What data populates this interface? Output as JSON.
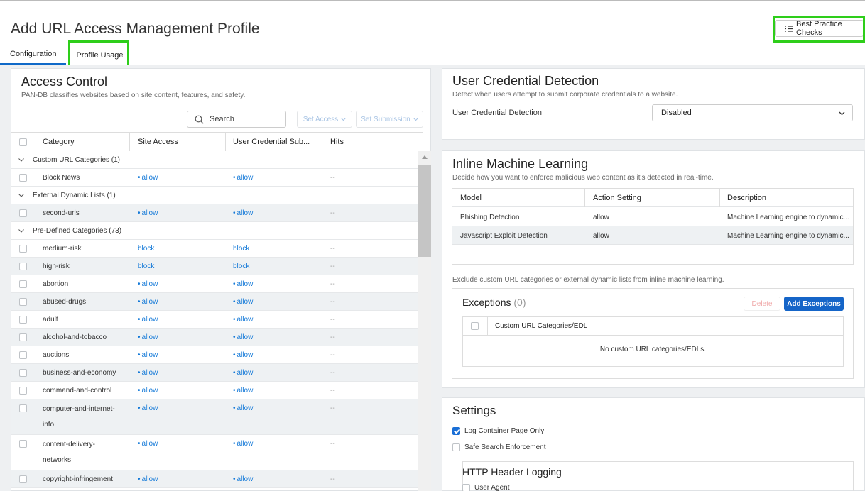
{
  "header": {
    "title": "Add URL Access Management Profile",
    "best_practice_label": "Best Practice Checks",
    "tabs": [
      {
        "label": "Configuration"
      },
      {
        "label": "Profile Usage"
      }
    ]
  },
  "access_control": {
    "title": "Access Control",
    "subtitle": "PAN-DB classifies websites based on site content, features, and safety.",
    "search_placeholder": "Search",
    "set_access_label": "Set Access",
    "set_submission_label": "Set Submission",
    "columns": [
      "Category",
      "Site Access",
      "User Credential Sub...",
      "Hits"
    ],
    "rows": [
      {
        "kind": "group",
        "label": "Custom URL Categories (1)"
      },
      {
        "kind": "item",
        "category": "Block News",
        "site": "allow",
        "cred": "allow",
        "hits": "--"
      },
      {
        "kind": "group",
        "label": "External Dynamic Lists (1)"
      },
      {
        "kind": "item",
        "category": "second-urls",
        "site": "allow",
        "cred": "allow",
        "hits": "--"
      },
      {
        "kind": "group",
        "label": "Pre-Defined Categories (73)"
      },
      {
        "kind": "item",
        "category": "medium-risk",
        "site": "block",
        "cred": "block",
        "hits": "--"
      },
      {
        "kind": "item",
        "category": "high-risk",
        "site": "block",
        "cred": "block",
        "hits": "--"
      },
      {
        "kind": "item",
        "category": "abortion",
        "site": "allow",
        "cred": "allow",
        "hits": "--"
      },
      {
        "kind": "item",
        "category": "abused-drugs",
        "site": "allow",
        "cred": "allow",
        "hits": "--"
      },
      {
        "kind": "item",
        "category": "adult",
        "site": "allow",
        "cred": "allow",
        "hits": "--"
      },
      {
        "kind": "item",
        "category": "alcohol-and-tobacco",
        "site": "allow",
        "cred": "allow",
        "hits": "--"
      },
      {
        "kind": "item",
        "category": "auctions",
        "site": "allow",
        "cred": "allow",
        "hits": "--"
      },
      {
        "kind": "item",
        "category": "business-and-economy",
        "site": "allow",
        "cred": "allow",
        "hits": "--"
      },
      {
        "kind": "item",
        "category": "command-and-control",
        "site": "allow",
        "cred": "allow",
        "hits": "--"
      },
      {
        "kind": "item",
        "category": "computer-and-internet-info",
        "site": "allow",
        "cred": "allow",
        "hits": "--",
        "lines": [
          "computer-and-internet-",
          "info"
        ]
      },
      {
        "kind": "item",
        "category": "content-delivery-networks",
        "site": "allow",
        "cred": "allow",
        "hits": "--",
        "lines": [
          "content-delivery-",
          "networks"
        ]
      },
      {
        "kind": "item",
        "category": "copyright-infringement",
        "site": "allow",
        "cred": "allow",
        "hits": "--"
      }
    ]
  },
  "user_credential": {
    "title": "User Credential Detection",
    "subtitle": "Detect when users attempt to submit corporate credentials to a website.",
    "field_label": "User Credential Detection",
    "value": "Disabled"
  },
  "inline_ml": {
    "title": "Inline Machine Learning",
    "subtitle": "Decide how you want to enforce malicious web content as it's detected in real-time.",
    "columns": [
      "Model",
      "Action Setting",
      "Description"
    ],
    "rows": [
      {
        "model": "Phishing Detection",
        "action": "allow",
        "description": "Machine Learning engine to dynamic..."
      },
      {
        "model": "Javascript Exploit Detection",
        "action": "allow",
        "description": "Machine Learning engine to dynamic..."
      }
    ],
    "exclude_note": "Exclude custom URL categories or external dynamic lists from inline machine learning.",
    "exceptions_label": "Exceptions",
    "exceptions_count": "(0)",
    "delete_label": "Delete",
    "add_label": "Add Exceptions",
    "exc_column": "Custom URL Categories/EDL",
    "exc_empty": "No custom URL categories/EDLs."
  },
  "settings": {
    "title": "Settings",
    "log_container": "Log Container Page Only",
    "safe_search": "Safe Search Enforcement",
    "http_header_title": "HTTP Header Logging",
    "user_agent": "User Agent"
  },
  "colors": {
    "accent": "#1565c8",
    "highlight": "#2ece1a",
    "link": "#157ad8"
  }
}
